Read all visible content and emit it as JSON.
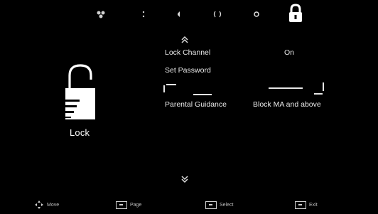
{
  "top_icons": [
    {
      "name": "picture-icon",
      "glyph": "✿"
    },
    {
      "name": "sound-mode-icon",
      "glyph": "♪"
    },
    {
      "name": "speaker-icon",
      "glyph": ""
    },
    {
      "name": "network-icon",
      "glyph": "( )"
    },
    {
      "name": "timer-icon",
      "glyph": "o"
    },
    {
      "name": "lock-tab-icon",
      "glyph": ""
    }
  ],
  "lock_panel": {
    "caption": "Lock"
  },
  "menu": {
    "lock_channel": {
      "label": "Lock Channel",
      "value": "On"
    },
    "set_password": {
      "label": "Set Password"
    },
    "parental_guidance": {
      "label": "Parental Guidance",
      "value": "Block MA and above"
    }
  },
  "help": {
    "move": "Move",
    "page": "Page",
    "select": "Select",
    "exit": "Exit"
  },
  "colors": {
    "background": "#000000",
    "text": "#eaeaea",
    "accent": "#ffffff"
  }
}
